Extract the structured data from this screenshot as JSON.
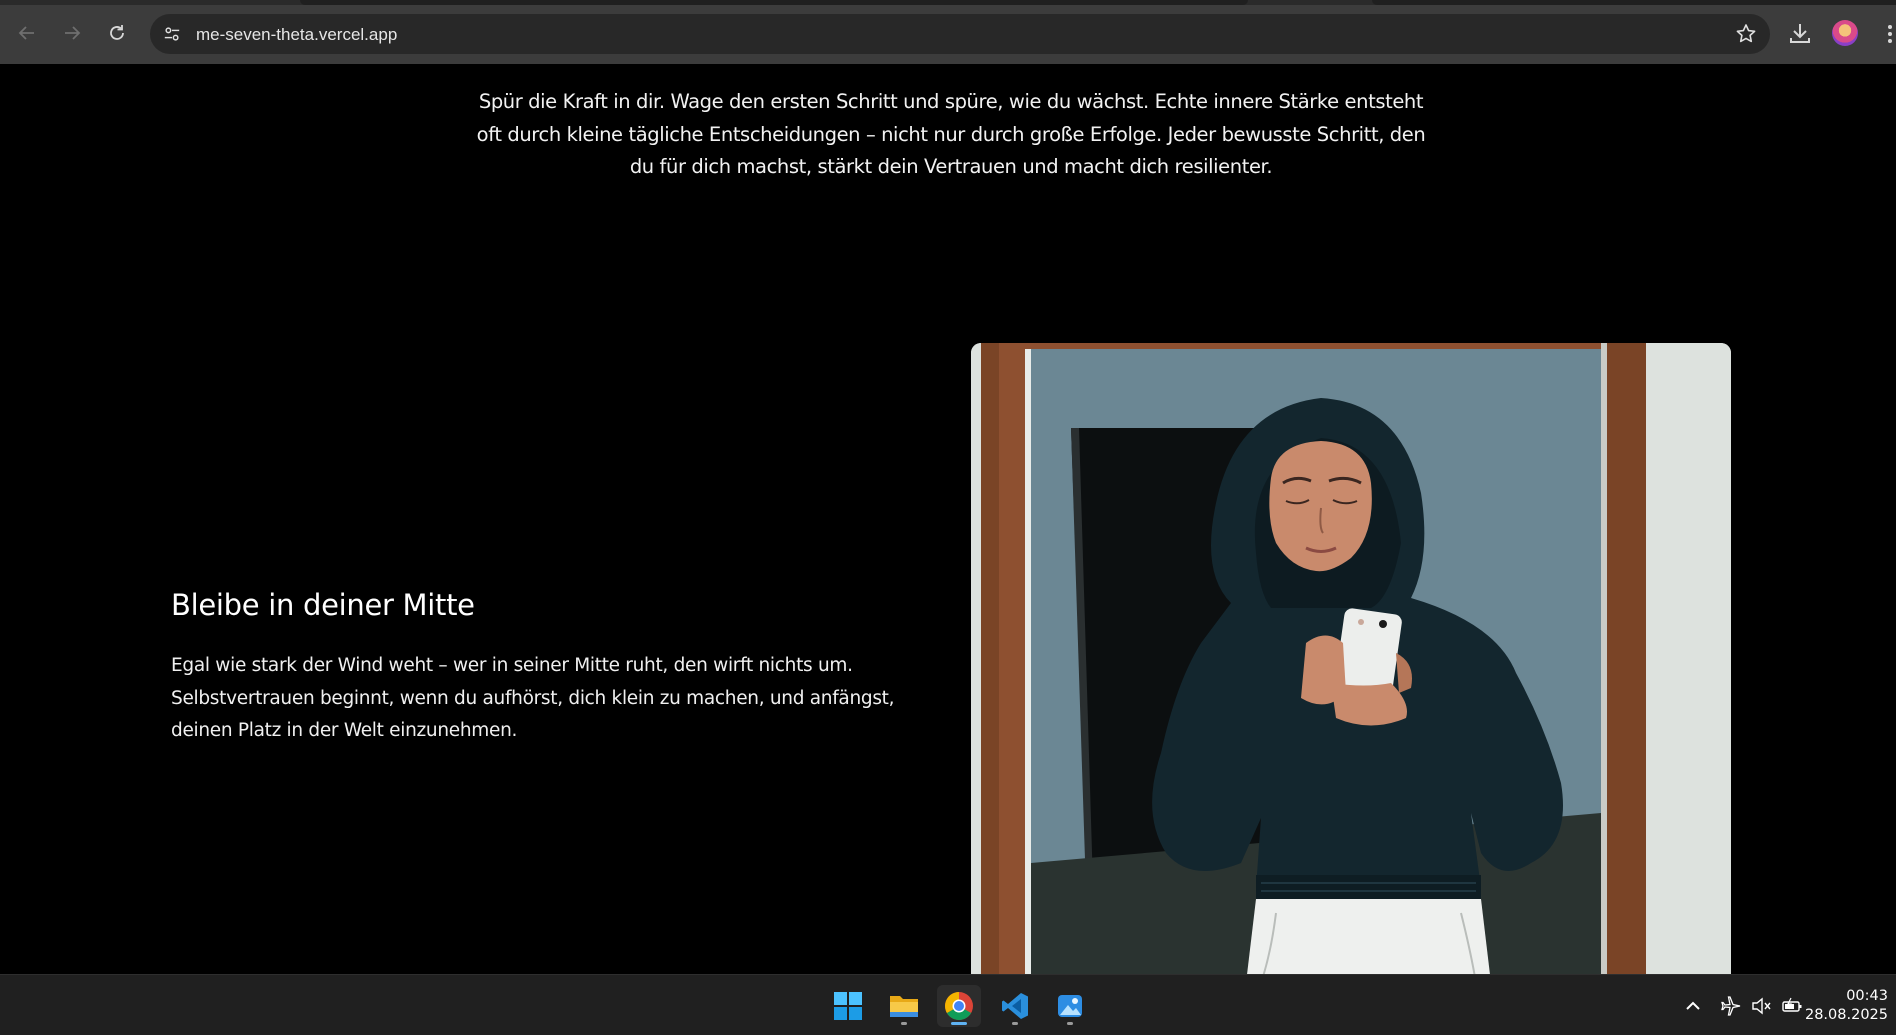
{
  "browser": {
    "url": "me-seven-theta.vercel.app",
    "icons": {
      "back": "arrow-left-icon",
      "forward": "arrow-right-icon",
      "reload": "reload-icon",
      "site_info": "site-settings-icon",
      "bookmark": "star-icon",
      "download": "download-icon",
      "profile": "avatar",
      "menu": "kebab-menu-icon"
    }
  },
  "page": {
    "intro_text": "Spür die Kraft in dir. Wage den ersten Schritt und spüre, wie du wächst. Echte innere Stärke entsteht oft durch kleine tägliche Entscheidungen – nicht nur durch große Erfolge. Jeder bewusste Schritt, den du für dich machst, stärkt dein Vertrauen und macht dich resilienter.",
    "section": {
      "title": "Bleibe in deiner Mitte",
      "body": "Egal wie stark der Wind weht – wer in seiner Mitte ruht, den wirft nichts um. Selbstvertrauen beginnt, wenn du aufhörst, dich klein zu machen, und anfängst, deinen Platz in der Welt einzunehmen."
    }
  },
  "taskbar": {
    "apps": [
      "windows-start",
      "file-explorer",
      "chrome",
      "vscode",
      "photos"
    ],
    "active_app": "chrome",
    "time": "00:43",
    "date": "28.08.2025"
  },
  "colors": {
    "page_bg": "#000000",
    "chrome_bg": "#3c3c3c",
    "taskbar_bg": "#202020",
    "accent": "#5fb2f2"
  }
}
